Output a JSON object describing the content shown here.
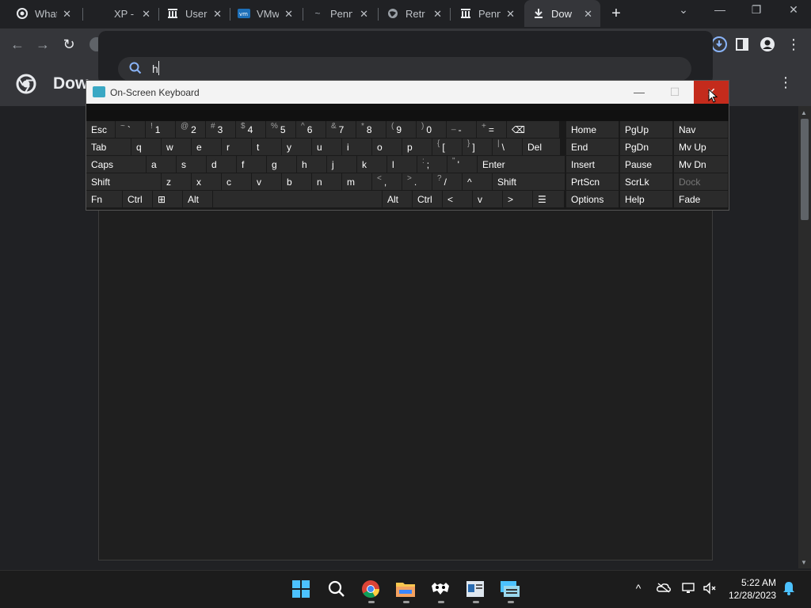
{
  "tabs": [
    {
      "title": "What",
      "icon": "chrome-icon"
    },
    {
      "title": "XP -",
      "icon": "blank-icon"
    },
    {
      "title": "User",
      "icon": "museum-icon"
    },
    {
      "title": "VMw",
      "icon": "vmware-icon"
    },
    {
      "title": "Penn",
      "icon": "arrow-icon"
    },
    {
      "title": "Retr",
      "icon": "globe-icon"
    },
    {
      "title": "Penn",
      "icon": "museum-icon"
    },
    {
      "title": "Dow",
      "icon": "download-icon"
    }
  ],
  "page": {
    "title": "Dow"
  },
  "search": {
    "value": "h"
  },
  "osk": {
    "title": "On-Screen Keyboard",
    "rows": [
      [
        {
          "label": "Esc"
        },
        {
          "shift": "~",
          "label": "`"
        },
        {
          "shift": "!",
          "label": "1"
        },
        {
          "shift": "@",
          "label": "2"
        },
        {
          "shift": "#",
          "label": "3"
        },
        {
          "shift": "$",
          "label": "4"
        },
        {
          "shift": "%",
          "label": "5"
        },
        {
          "shift": "^",
          "label": "6"
        },
        {
          "shift": "&",
          "label": "7"
        },
        {
          "shift": "*",
          "label": "8"
        },
        {
          "shift": "(",
          "label": "9"
        },
        {
          "shift": ")",
          "label": "0"
        },
        {
          "shift": "_",
          "label": "-"
        },
        {
          "shift": "+",
          "label": "="
        },
        {
          "label": "⌫"
        }
      ],
      [
        {
          "label": "Tab"
        },
        {
          "label": "q"
        },
        {
          "label": "w"
        },
        {
          "label": "e"
        },
        {
          "label": "r"
        },
        {
          "label": "t"
        },
        {
          "label": "y"
        },
        {
          "label": "u"
        },
        {
          "label": "i"
        },
        {
          "label": "o"
        },
        {
          "label": "p"
        },
        {
          "shift": "{",
          "label": "["
        },
        {
          "shift": "}",
          "label": "]"
        },
        {
          "shift": "|",
          "label": "\\"
        },
        {
          "label": "Del"
        }
      ],
      [
        {
          "label": "Caps"
        },
        {
          "label": "a"
        },
        {
          "label": "s"
        },
        {
          "label": "d"
        },
        {
          "label": "f"
        },
        {
          "label": "g"
        },
        {
          "label": "h"
        },
        {
          "label": "j"
        },
        {
          "label": "k"
        },
        {
          "label": "l"
        },
        {
          "shift": ":",
          "label": ";"
        },
        {
          "shift": "\"",
          "label": "'"
        },
        {
          "label": "Enter"
        }
      ],
      [
        {
          "label": "Shift"
        },
        {
          "label": "z"
        },
        {
          "label": "x"
        },
        {
          "label": "c"
        },
        {
          "label": "v"
        },
        {
          "label": "b"
        },
        {
          "label": "n"
        },
        {
          "label": "m"
        },
        {
          "shift": "<",
          "label": ","
        },
        {
          "shift": ">",
          "label": "."
        },
        {
          "shift": "?",
          "label": "/"
        },
        {
          "label": "^"
        },
        {
          "label": "Shift"
        }
      ],
      [
        {
          "label": "Fn"
        },
        {
          "label": "Ctrl"
        },
        {
          "label": "⊞"
        },
        {
          "label": "Alt"
        },
        {
          "label": ""
        },
        {
          "label": "Alt"
        },
        {
          "label": "Ctrl"
        },
        {
          "label": "<"
        },
        {
          "label": "v"
        },
        {
          "label": ">"
        },
        {
          "label": "☰"
        }
      ]
    ],
    "nav_keys": [
      [
        "Home",
        "PgUp",
        "Nav"
      ],
      [
        "End",
        "PgDn",
        "Mv Up"
      ],
      [
        "Insert",
        "Pause",
        "Mv Dn"
      ],
      [
        "PrtScn",
        "ScrLk",
        "Dock"
      ],
      [
        "Options",
        "Help",
        "Fade"
      ]
    ]
  },
  "taskbar": {
    "apps": [
      "start-icon",
      "search-icon",
      "chrome-icon",
      "file-explorer-icon",
      "game-icon",
      "app-icon",
      "on-screen-keyboard-icon"
    ],
    "time": "5:22 AM",
    "date": "12/28/2023"
  }
}
